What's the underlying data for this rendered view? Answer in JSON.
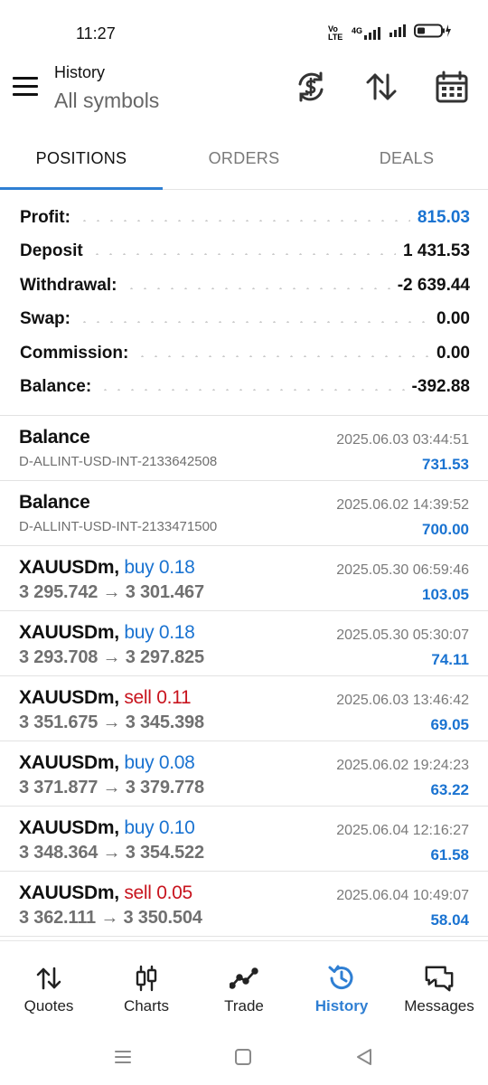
{
  "status_bar": {
    "time": "11:27",
    "network_label": "4G",
    "volte_label": "Vo LTE"
  },
  "header": {
    "title": "History",
    "subtitle": "All symbols",
    "icons": [
      "currency-sync-icon",
      "sort-icon",
      "calendar-icon"
    ]
  },
  "tabs": [
    {
      "label": "POSITIONS",
      "active": true
    },
    {
      "label": "ORDERS",
      "active": false
    },
    {
      "label": "DEALS",
      "active": false
    }
  ],
  "summary": [
    {
      "label": "Profit:",
      "value": "815.03",
      "highlight": true
    },
    {
      "label": "Deposit",
      "value": "1 431.53",
      "highlight": false
    },
    {
      "label": "Withdrawal:",
      "value": "-2 639.44",
      "highlight": false
    },
    {
      "label": "Swap:",
      "value": "0.00",
      "highlight": false
    },
    {
      "label": "Commission:",
      "value": "0.00",
      "highlight": false
    },
    {
      "label": "Balance:",
      "value": "-392.88",
      "highlight": false
    }
  ],
  "deals": [
    {
      "symbol": "Balance",
      "detail": "D-ALLINT-USD-INT-2133642508",
      "date": "2025.06.03 03:44:51",
      "profit": "731.53"
    },
    {
      "symbol": "Balance",
      "detail": "D-ALLINT-USD-INT-2133471500",
      "date": "2025.06.02 14:39:52",
      "profit": "700.00"
    },
    {
      "symbol": "XAUUSDm,",
      "side": "buy 0.18",
      "side_type": "buy",
      "open": "3 295.742",
      "arrow": "→",
      "close": "3 301.467",
      "date": "2025.05.30 06:59:46",
      "profit": "103.05"
    },
    {
      "symbol": "XAUUSDm,",
      "side": "buy 0.18",
      "side_type": "buy",
      "open": "3 293.708",
      "arrow": "→",
      "close": "3 297.825",
      "date": "2025.05.30 05:30:07",
      "profit": "74.11"
    },
    {
      "symbol": "XAUUSDm,",
      "side": "sell 0.11",
      "side_type": "sell",
      "open": "3 351.675",
      "arrow": "→",
      "close": "3 345.398",
      "date": "2025.06.03 13:46:42",
      "profit": "69.05"
    },
    {
      "symbol": "XAUUSDm,",
      "side": "buy 0.08",
      "side_type": "buy",
      "open": "3 371.877",
      "arrow": "→",
      "close": "3 379.778",
      "date": "2025.06.02 19:24:23",
      "profit": "63.22"
    },
    {
      "symbol": "XAUUSDm,",
      "side": "buy 0.10",
      "side_type": "buy",
      "open": "3 348.364",
      "arrow": "→",
      "close": "3 354.522",
      "date": "2025.06.04 12:16:27",
      "profit": "61.58"
    },
    {
      "symbol": "XAUUSDm,",
      "side": "sell 0.05",
      "side_type": "sell",
      "open": "3 362.111",
      "arrow": "→",
      "close": "3 350.504",
      "date": "2025.06.04 10:49:07",
      "profit": "58.04"
    }
  ],
  "bottom_nav": [
    {
      "label": "Quotes",
      "icon": "quotes-arrows-icon",
      "active": false
    },
    {
      "label": "Charts",
      "icon": "candlestick-icon",
      "active": false
    },
    {
      "label": "Trade",
      "icon": "trend-line-icon",
      "active": false
    },
    {
      "label": "History",
      "icon": "history-clock-icon",
      "active": true
    },
    {
      "label": "Messages",
      "icon": "chat-bubbles-icon",
      "active": false
    }
  ],
  "colors": {
    "accent_blue": "#2f7fd3",
    "profit_blue": "#1a73d1",
    "sell_red": "#c8141e"
  }
}
